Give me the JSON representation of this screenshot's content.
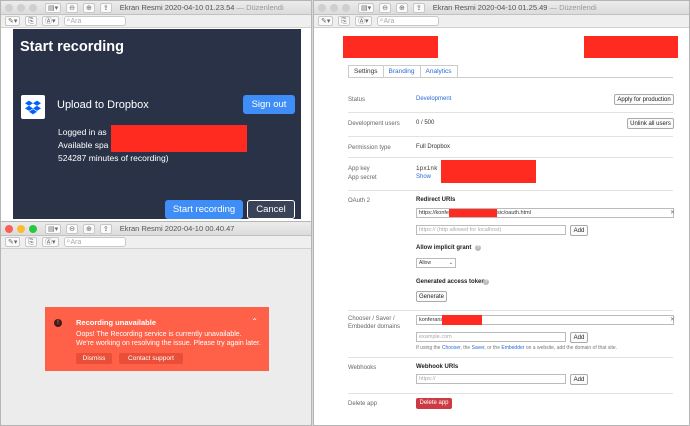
{
  "windows": {
    "w1": {
      "title": "Ekran Resmi 2020-04-10 01.23.54",
      "subtitle": "— Düzenlendi"
    },
    "w2": {
      "title": "Ekran Resmi 2020-04-10 00.40.47"
    },
    "w3": {
      "title": "Ekran Resmi 2020-04-10 01.25.49",
      "subtitle": "— Düzenlendi"
    }
  },
  "toolbar": {
    "search_placeholder": "Ara"
  },
  "recorder": {
    "heading": "Start recording",
    "service": "Upload to Dropbox",
    "sign_out": "Sign out",
    "logged_in": "Logged in as",
    "available": "Available spa",
    "minutes": "524287 minutes of recording)",
    "start_btn": "Start recording",
    "cancel_btn": "Cancel"
  },
  "alert": {
    "title": "Recording unavailable",
    "message": "Oops! The Recording service is currently unavailable. We're working on resolving the issue. Please try again later.",
    "dismiss": "Dismiss",
    "contact": "Contact support"
  },
  "app_console": {
    "tabs": [
      "Settings",
      "Branding",
      "Analytics"
    ],
    "status_label": "Status",
    "status_value": "Development",
    "apply_btn": "Apply for production",
    "dev_users_label": "Development users",
    "dev_users_value": "0 / 500",
    "unlink_btn": "Unlink all users",
    "permission_label": "Permission type",
    "permission_value": "Full Dropbox",
    "app_key_label": "App key",
    "app_secret_label": "App secret",
    "app_key_value": "ipxink",
    "show_link": "Show",
    "oauth_label": "OAuth 2",
    "redirect_title": "Redirect URIs",
    "redirect_prefix": "https://konfe",
    "redirect_suffix": "sic/oauth.html",
    "redirect_placeholder": "https:// (http allowed for localhost)",
    "add_btn": "Add",
    "implicit_title": "Allow implicit grant",
    "implicit_value": "Allow",
    "token_title": "Generated access token",
    "generate_btn": "Generate",
    "chooser_label": "Chooser / Saver / Embedder domains",
    "chooser_value": "konferans",
    "domain_placeholder": "example.com",
    "chooser_note_pre": "If using the",
    "chooser_note_chooser": "Chooser",
    "chooser_note_saver": "Saver",
    "chooser_note_or": ", or the",
    "chooser_note_embedder": "Embedder",
    "chooser_note_post": "on a website, add the domain of that site.",
    "webhooks_label": "Webhooks",
    "webhook_title": "Webhook URIs",
    "webhook_placeholder": "https://",
    "delete_label": "Delete app",
    "delete_btn": "Delete app"
  },
  "colors": {
    "redaction": "#ff2b21",
    "dropbox_blue": "#3f8ef8",
    "alert": "#fe6148",
    "delete": "#cc3b43"
  }
}
